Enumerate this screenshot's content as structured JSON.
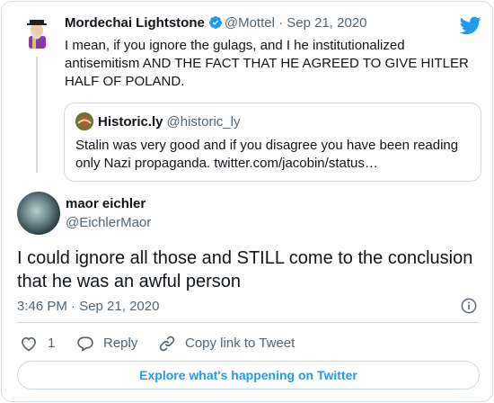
{
  "parent_tweet": {
    "name": "Mordechai Lightstone",
    "handle": "@Mottel",
    "separator": "·",
    "date": "Sep 21, 2020",
    "text": "I mean, if you ignore the gulags, and I he institutionalized antisemitism AND THE FACT THAT HE AGREED TO GIVE HITLER HALF OF POLAND."
  },
  "quoted_tweet": {
    "name": "Historic.ly",
    "handle": "@historic_ly",
    "text": "Stalin was very good and if you disagree you have been reading only Nazi propaganda. twitter.com/jacobin/status…"
  },
  "main_tweet": {
    "name": "maor eichler",
    "handle": "@EichlerMaor",
    "text": "I could ignore all those and STILL come to the conclusion that he was an awful person",
    "timestamp": "3:46 PM · Sep 21, 2020"
  },
  "actions": {
    "like_count": "1",
    "reply_label": "Reply",
    "copy_label": "Copy link to Tweet"
  },
  "explore_label": "Explore what's happening on Twitter",
  "colors": {
    "accent": "#1d9bf0",
    "muted": "#536471",
    "border": "#cfd9de"
  },
  "icons": [
    "verified-badge-icon",
    "twitter-bird-icon",
    "info-icon",
    "heart-icon",
    "reply-bubble-icon",
    "link-icon"
  ]
}
